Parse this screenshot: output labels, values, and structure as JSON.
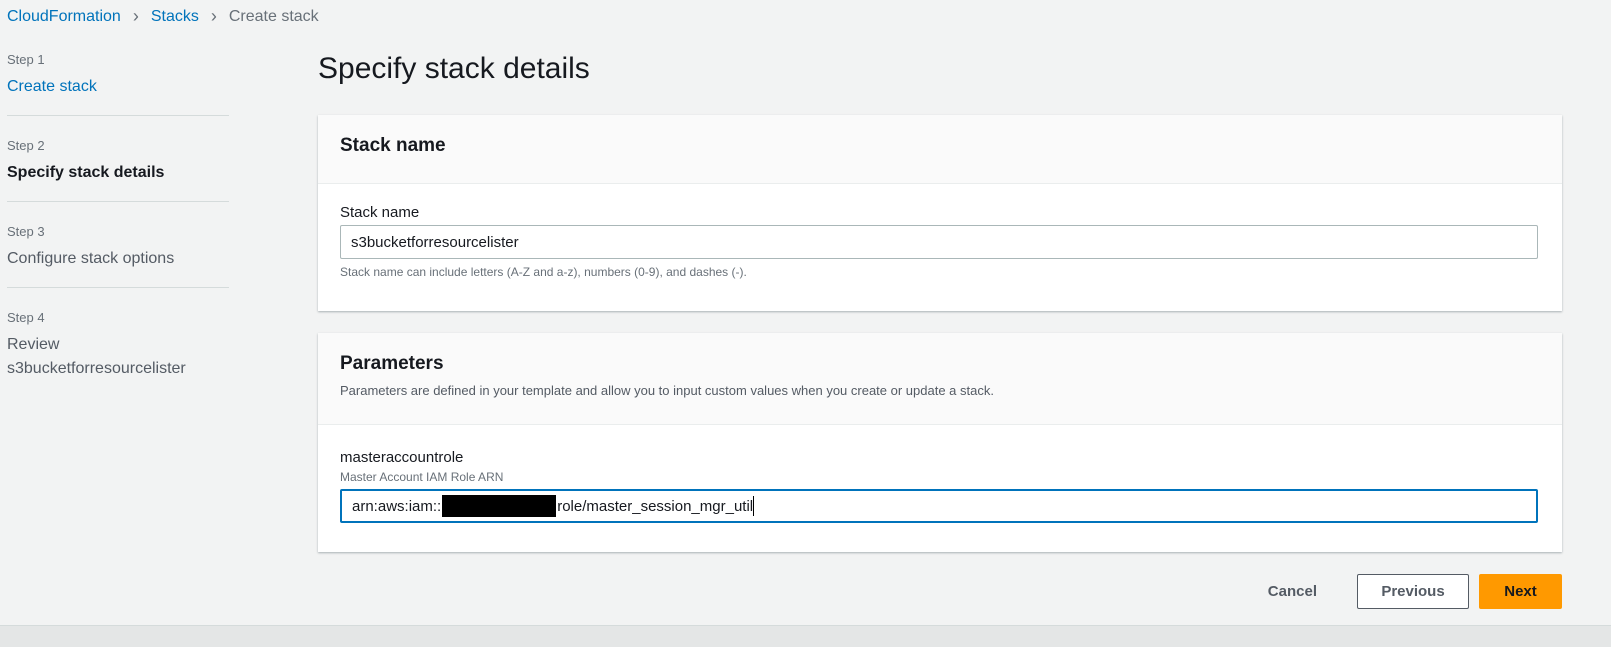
{
  "breadcrumb": {
    "items": [
      "CloudFormation",
      "Stacks"
    ],
    "current": "Create stack"
  },
  "steps": [
    {
      "num": "Step 1",
      "label": "Create stack"
    },
    {
      "num": "Step 2",
      "label": "Specify stack details"
    },
    {
      "num": "Step 3",
      "label": "Configure stack options"
    },
    {
      "num": "Step 4",
      "label": "Review",
      "sub": "s3bucketforresourcelister"
    }
  ],
  "page_title": "Specify stack details",
  "stack_panel": {
    "title": "Stack name",
    "field_label": "Stack name",
    "value": "s3bucketforresourcelister",
    "hint": "Stack name can include letters (A-Z and a-z), numbers (0-9), and dashes (-)."
  },
  "params_panel": {
    "title": "Parameters",
    "description": "Parameters are defined in your template and allow you to input custom values when you create or update a stack.",
    "param_name": "masteraccountrole",
    "param_desc": "Master Account IAM Role ARN",
    "value_prefix": "arn:aws:iam::",
    "value_suffix": "role/master_session_mgr_util"
  },
  "buttons": {
    "cancel": "Cancel",
    "previous": "Previous",
    "next": "Next"
  }
}
